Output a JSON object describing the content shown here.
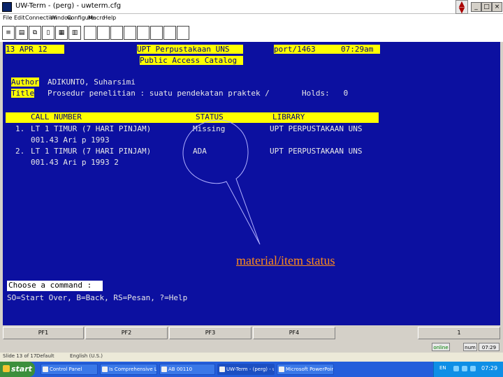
{
  "window": {
    "title": "UW-Term - (perg) - uwterm.cfg",
    "minimize": "_",
    "maximize": "□",
    "close": "×"
  },
  "menu": [
    "File",
    "Edit",
    "Connection",
    "Window",
    "Configure",
    "Macro",
    "Help"
  ],
  "terminal": {
    "date": "13 APR 12",
    "library": "UPT Perpustakaan UNS",
    "port": "port/1463",
    "time": "07:29am",
    "catalog": "Public Access Catalog",
    "author_label": "Author",
    "author": "ADIKUNTO, Suharsimi",
    "title_label": "Title",
    "title": "Prosedur penelitian : suatu pendekatan praktek /",
    "holds": "Holds:   0",
    "columns": [
      "CALL NUMBER",
      "STATUS",
      "LIBRARY"
    ],
    "rows": [
      {
        "num": "1.",
        "call1": "LT 1 TIMUR (7 HARI PINJAM)",
        "call2": "001.43 Ari p 1993",
        "status": "Missing",
        "library": "UPT PERPUSTAKAAN UNS"
      },
      {
        "num": "2.",
        "call1": "LT 1 TIMUR (7 HARI PINJAM)",
        "call2": "001.43 Ari p 1993 2",
        "status": "ADA",
        "library": "UPT PERPUSTAKAAN UNS"
      }
    ],
    "prompt": "Choose a command :",
    "commands": "SO=Start Over, B=Back, RS=Pesan, ?=Help"
  },
  "callout": {
    "label": "material/item status",
    "color": "#ff8c1a"
  },
  "fkeys": [
    "PF1",
    "PF2",
    "PF3",
    "PF4",
    "1"
  ],
  "status": {
    "online": "online",
    "num": "num",
    "time": "07:29"
  },
  "filebar": {
    "left": "Slide 13 of 17",
    "middle": "Default",
    "right": "English (U.S.)"
  },
  "taskbar": {
    "start": "start",
    "tasks": [
      "Control Panel",
      "Is Comprehensive Lit...",
      "AB 00110",
      "UW-Term - (perg) - uwt...",
      "Microsoft PowerPoint..."
    ],
    "lang": "EN",
    "clock": "07:29"
  },
  "colors": {
    "terminal_bg": "#0c10a0",
    "highlight": "#ffff00",
    "taskbar": "#245edb"
  }
}
